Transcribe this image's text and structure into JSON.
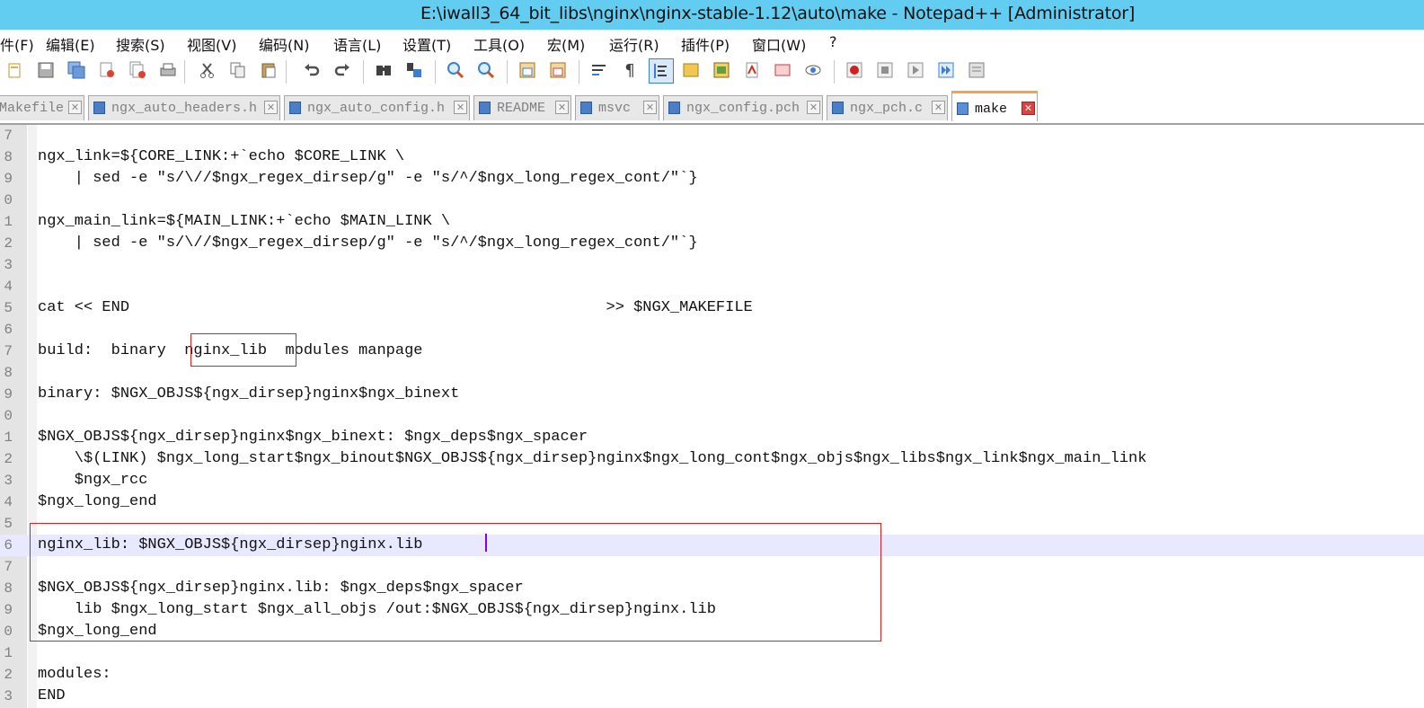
{
  "window": {
    "title": "E:\\iwall3_64_bit_libs\\nginx\\nginx-stable-1.12\\auto\\make - Notepad++ [Administrator]"
  },
  "menu": [
    "件(F)",
    "编辑(E)",
    "搜索(S)",
    "视图(V)",
    "编码(N)",
    "语言(L)",
    "设置(T)",
    "工具(O)",
    "宏(M)",
    "运行(R)",
    "插件(P)",
    "窗口(W)",
    "?"
  ],
  "toolbar_icons": [
    "new-file-icon",
    "open-file-icon",
    "save-icon",
    "save-all-icon",
    "close-icon",
    "close-all-icon",
    "print-icon",
    "cut-icon",
    "copy-icon",
    "paste-icon",
    "undo-icon",
    "redo-icon",
    "find-icon",
    "replace-icon",
    "zoom-in-icon",
    "zoom-out-icon",
    "sync-v-icon",
    "sync-h-icon",
    "word-wrap-icon",
    "show-all-chars-icon",
    "indent-guide-icon",
    "doc-map-icon",
    "function-list-icon",
    "folder-workspace-icon",
    "monitor-icon",
    "eye-icon",
    "record-macro-icon",
    "stop-macro-icon",
    "play-macro-icon",
    "run-macro-multiple-icon",
    "save-macro-icon"
  ],
  "tabs": [
    {
      "label": "Makefile",
      "active": false
    },
    {
      "label": "ngx_auto_headers.h",
      "active": false
    },
    {
      "label": "ngx_auto_config.h",
      "active": false
    },
    {
      "label": "README",
      "active": false
    },
    {
      "label": "msvc",
      "active": false
    },
    {
      "label": "ngx_config.pch",
      "active": false
    },
    {
      "label": "ngx_pch.c",
      "active": false
    },
    {
      "label": "make",
      "active": true
    }
  ],
  "tab_close_glyph": "✕",
  "editor": {
    "lines": [
      {
        "num": "7",
        "text": ""
      },
      {
        "num": "8",
        "text": "ngx_link=${CORE_LINK:+`echo $CORE_LINK \\"
      },
      {
        "num": "9",
        "text": "    | sed -e \"s/\\//$ngx_regex_dirsep/g\" -e \"s/^/$ngx_long_regex_cont/\"`}"
      },
      {
        "num": "0",
        "text": ""
      },
      {
        "num": "1",
        "text": "ngx_main_link=${MAIN_LINK:+`echo $MAIN_LINK \\"
      },
      {
        "num": "2",
        "text": "    | sed -e \"s/\\//$ngx_regex_dirsep/g\" -e \"s/^/$ngx_long_regex_cont/\"`}"
      },
      {
        "num": "3",
        "text": ""
      },
      {
        "num": "4",
        "text": ""
      },
      {
        "num": "5",
        "text": "cat << END                                                    >> $NGX_MAKEFILE"
      },
      {
        "num": "6",
        "text": ""
      },
      {
        "num": "7",
        "text": "build:  binary  nginx_lib  modules manpage"
      },
      {
        "num": "8",
        "text": ""
      },
      {
        "num": "9",
        "text": "binary: $NGX_OBJS${ngx_dirsep}nginx$ngx_binext"
      },
      {
        "num": "0",
        "text": ""
      },
      {
        "num": "1",
        "text": "$NGX_OBJS${ngx_dirsep}nginx$ngx_binext: $ngx_deps$ngx_spacer"
      },
      {
        "num": "2",
        "text": "    \\$(LINK) $ngx_long_start$ngx_binout$NGX_OBJS${ngx_dirsep}nginx$ngx_long_cont$ngx_objs$ngx_libs$ngx_link$ngx_main_link"
      },
      {
        "num": "3",
        "text": "    $ngx_rcc"
      },
      {
        "num": "4",
        "text": "$ngx_long_end"
      },
      {
        "num": "5",
        "text": ""
      },
      {
        "num": "6",
        "text": "nginx_lib: $NGX_OBJS${ngx_dirsep}nginx.lib",
        "current": true
      },
      {
        "num": "7",
        "text": ""
      },
      {
        "num": "8",
        "text": "$NGX_OBJS${ngx_dirsep}nginx.lib: $ngx_deps$ngx_spacer"
      },
      {
        "num": "9",
        "text": "    lib $ngx_long_start $ngx_all_objs /out:$NGX_OBJS${ngx_dirsep}nginx.lib"
      },
      {
        "num": "0",
        "text": "$ngx_long_end"
      },
      {
        "num": "1",
        "text": ""
      },
      {
        "num": "2",
        "text": "modules:"
      },
      {
        "num": "3",
        "text": "END"
      }
    ]
  },
  "colors": {
    "titlebar": "#62cdf0",
    "highlight_box": "#e02020",
    "current_line": "#e8e8ff",
    "caret": "#8000ff",
    "active_tab_accent": "#f5a34a"
  }
}
